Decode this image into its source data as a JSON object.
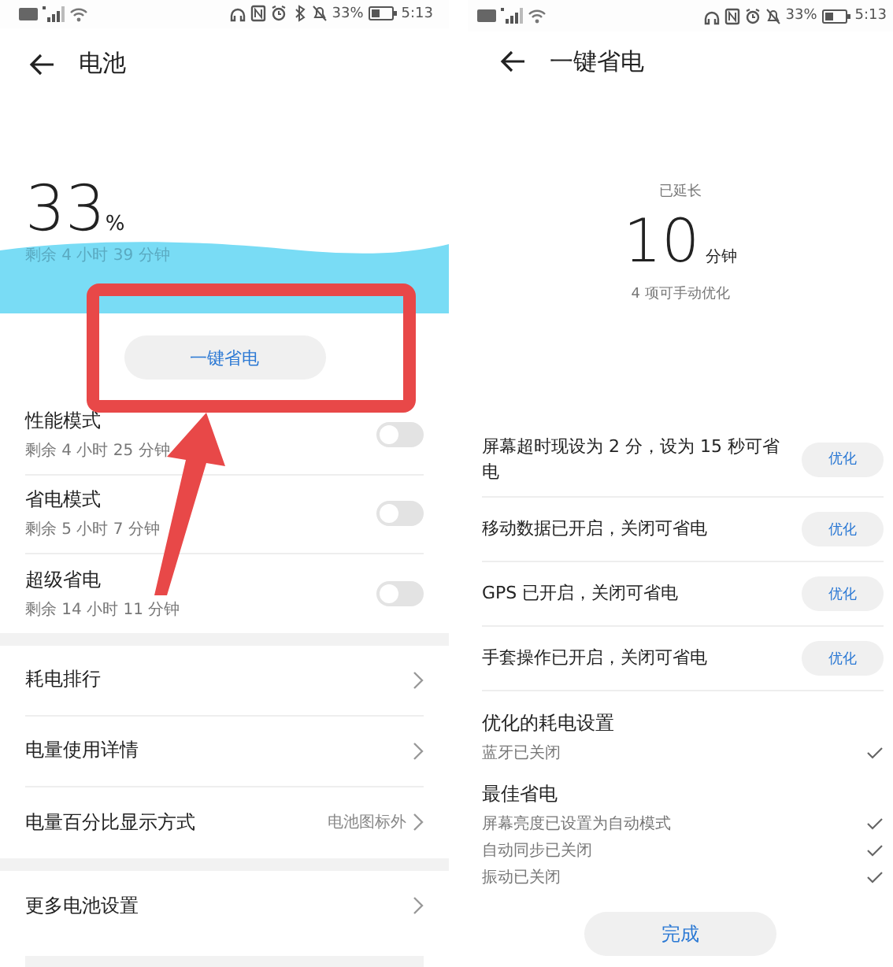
{
  "battery_screen": {
    "status_bar": {
      "bluetooth": true,
      "battery_text": "33%",
      "time": "5:13"
    },
    "title": "电池",
    "level_number": "33",
    "level_unit": "%",
    "remaining": "剩余 4 小时 39 分钟",
    "optimize_button": "一键省电",
    "modes": [
      {
        "name": "性能模式",
        "remaining": "剩余 4 小时 25 分钟",
        "on": false
      },
      {
        "name": "省电模式",
        "remaining": "剩余 5 小时 7 分钟",
        "on": false
      },
      {
        "name": "超级省电",
        "remaining": "剩余 14 小时 11 分钟",
        "on": false
      }
    ],
    "menu_groups": [
      [
        {
          "label": "耗电排行"
        },
        {
          "label": "电量使用详情"
        },
        {
          "label": "电量百分比显示方式",
          "value": "电池图标外"
        }
      ],
      [
        {
          "label": "更多电池设置"
        }
      ]
    ]
  },
  "power_saving_screen": {
    "status_bar": {
      "bluetooth": false,
      "battery_text": "33%",
      "time": "5:13"
    },
    "title": "一键省电",
    "extended_label": "已延长",
    "extended_value": "10",
    "extended_unit": "分钟",
    "manual_count": "4 项可手动优化",
    "suggestions": [
      {
        "text": "屏幕超时现设为 2 分，设为 15 秒可省电",
        "action": "优化"
      },
      {
        "text": "移动数据已开启，关闭可省电",
        "action": "优化"
      },
      {
        "text": "GPS 已开启，关闭可省电",
        "action": "优化"
      },
      {
        "text": "手套操作已开启，关闭可省电",
        "action": "优化"
      }
    ],
    "sections": [
      {
        "title": "优化的耗电设置",
        "items": [
          {
            "text": "蓝牙已关闭",
            "checked": true
          }
        ]
      },
      {
        "title": "最佳省电",
        "items": [
          {
            "text": "屏幕亮度已设置为自动模式",
            "checked": true
          },
          {
            "text": "自动同步已关闭",
            "checked": true
          },
          {
            "text": "振动已关闭",
            "checked": true
          }
        ]
      }
    ],
    "done_button": "完成"
  }
}
